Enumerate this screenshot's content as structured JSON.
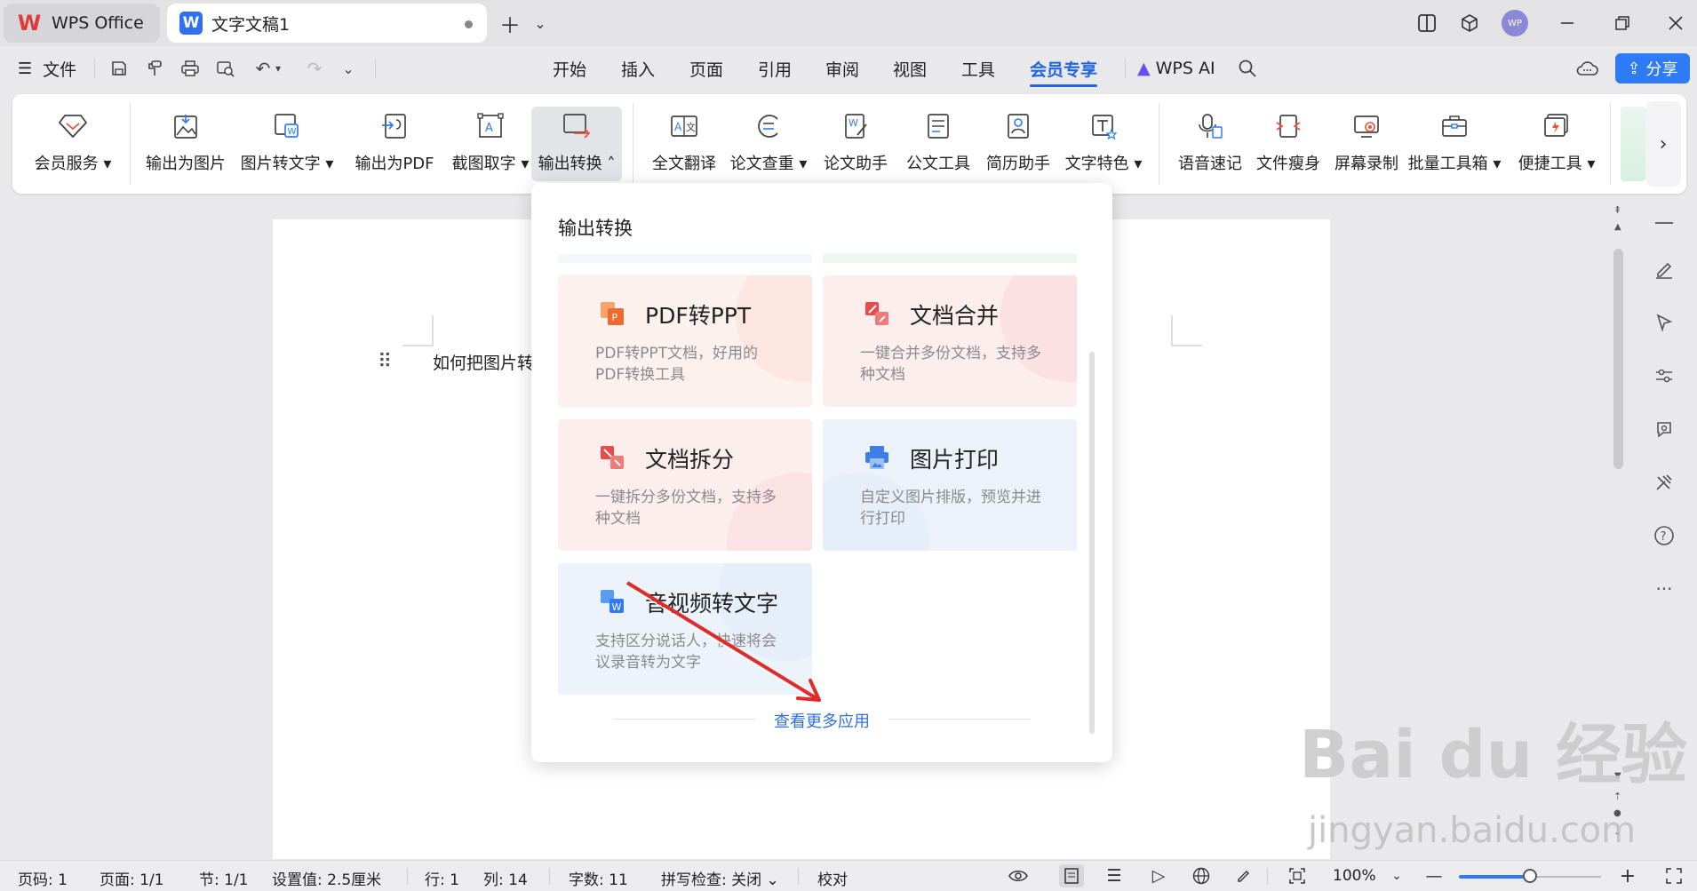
{
  "titlebar": {
    "wps_tab": "WPS Office",
    "doc_tab": "文字文稿1",
    "avatar_text": "WP"
  },
  "menubar": {
    "file": "文件",
    "tabs": [
      "开始",
      "插入",
      "页面",
      "引用",
      "审阅",
      "视图",
      "工具",
      "会员专享"
    ],
    "active_tab": "会员专享",
    "wps_ai": "WPS AI",
    "share": "分享"
  },
  "ribbon": {
    "items": [
      "会员服务",
      "输出为图片",
      "图片转文字",
      "输出为PDF",
      "截图取字",
      "输出转换",
      "全文翻译",
      "论文查重",
      "论文助手",
      "公文工具",
      "简历助手",
      "文字特色",
      "语音速记",
      "文件瘦身",
      "屏幕录制",
      "批量工具箱",
      "便捷工具"
    ]
  },
  "document": {
    "text": "如何把图片转"
  },
  "popup": {
    "title": "输出转换",
    "cards": [
      {
        "title": "PDF转PPT",
        "desc": "PDF转PPT文档，好用的PDF转换工具"
      },
      {
        "title": "文档合并",
        "desc": "一键合并多份文档，支持多种文档"
      },
      {
        "title": "文档拆分",
        "desc": "一键拆分多份文档，支持多种文档"
      },
      {
        "title": "图片打印",
        "desc": "自定义图片排版，预览并进行打印"
      },
      {
        "title": "音视频转文字",
        "desc": "支持区分说话人，快速将会议录音转为文字"
      }
    ],
    "more": "查看更多应用"
  },
  "statusbar": {
    "page_code": "页码: 1",
    "page": "页面: 1/1",
    "section": "节: 1/1",
    "setting": "设置值: 2.5厘米",
    "row": "行: 1",
    "col": "列: 14",
    "words": "字数: 11",
    "spell": "拼写检查: 关闭",
    "proof": "校对",
    "zoom": "100%"
  },
  "watermark": {
    "main": "Bai du 经验",
    "sub": "jingyan.baidu.com"
  },
  "colors": {
    "accent": "#2065e0",
    "share": "#2f7bf5",
    "link": "#2f6fe0"
  }
}
